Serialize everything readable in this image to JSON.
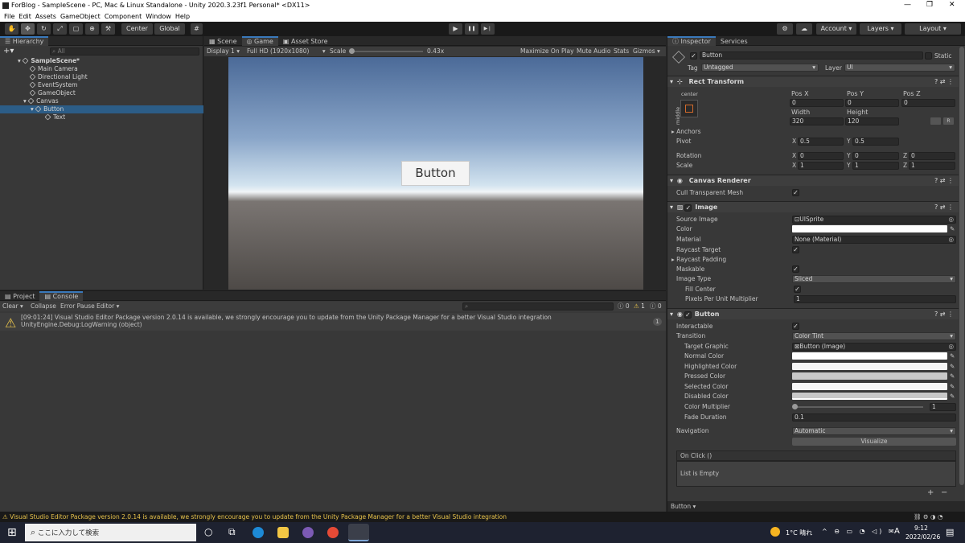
{
  "window": {
    "title": "ForBlog - SampleScene - PC, Mac & Linux Standalone - Unity 2020.3.23f1 Personal* <DX11>",
    "minimize": "—",
    "maximize": "❐",
    "close": "✕"
  },
  "menu": [
    "File",
    "Edit",
    "Assets",
    "GameObject",
    "Component",
    "Window",
    "Help"
  ],
  "toolbar": {
    "center": "Center",
    "global": "Global",
    "account": "Account",
    "layers": "Layers",
    "layout": "Layout",
    "play": "▶",
    "pause": "❚❚",
    "step": "▶❘"
  },
  "hierarchy": {
    "tab": "Hierarchy",
    "search_placeholder": "All",
    "items": [
      {
        "label": "SampleScene*"
      },
      {
        "label": "Main Camera"
      },
      {
        "label": "Directional Light"
      },
      {
        "label": "EventSystem"
      },
      {
        "label": "GameObject"
      },
      {
        "label": "Canvas"
      },
      {
        "label": "Button"
      },
      {
        "label": "Text"
      }
    ]
  },
  "game": {
    "tabs": [
      "Scene",
      "Game",
      "Asset Store"
    ],
    "display": "Display 1",
    "resolution": "Full HD (1920x1080)",
    "scale_label": "Scale",
    "scale_value": "0.43x",
    "scale_slider_fraction": 0.0,
    "maximize": "Maximize On Play",
    "mute": "Mute Audio",
    "stats": "Stats",
    "gizmos": "Gizmos",
    "button_text": "Button"
  },
  "console": {
    "tabs": [
      "Project",
      "Console"
    ],
    "clear": "Clear",
    "collapse": "Collapse",
    "error_pause": "Error Pause",
    "editor": "Editor",
    "count_info": "0",
    "count_warn": "1",
    "count_err": "0",
    "message_line1": "[09:01:24] Visual Studio Editor Package version 2.0.14 is available, we strongly encourage you to update from the Unity Package Manager for a better Visual Studio integration",
    "message_line2": "UnityEngine.Debug:LogWarning (object)",
    "message_count": "1"
  },
  "inspector": {
    "tabs": [
      "Inspector",
      "Services"
    ],
    "object_name": "Button",
    "static": "Static",
    "tag_label": "Tag",
    "tag_value": "Untagged",
    "layer_label": "Layer",
    "layer_value": "UI",
    "rect": {
      "title": "Rect Transform",
      "anchor_h": "center",
      "anchor_v": "middle",
      "posx_label": "Pos X",
      "posy_label": "Pos Y",
      "posz_label": "Pos Z",
      "posx": "0",
      "posy": "0",
      "posz": "0",
      "width_label": "Width",
      "height_label": "Height",
      "width": "320",
      "height": "120",
      "anchors": "Anchors",
      "pivot": "Pivot",
      "pivot_x": "0.5",
      "pivot_y": "0.5",
      "rotation": "Rotation",
      "rot_x": "0",
      "rot_y": "0",
      "rot_z": "0",
      "scale": "Scale",
      "scale_x": "1",
      "scale_y": "1",
      "scale_z": "1",
      "x": "X",
      "y": "Y",
      "z": "Z",
      "btn_r": "R"
    },
    "canvas_renderer": {
      "title": "Canvas Renderer",
      "cull": "Cull Transparent Mesh"
    },
    "image": {
      "title": "Image",
      "source_label": "Source Image",
      "source_value": "UISprite",
      "color_label": "Color",
      "material_label": "Material",
      "material_value": "None (Material)",
      "raycast_target": "Raycast Target",
      "raycast_padding": "Raycast Padding",
      "maskable": "Maskable",
      "image_type_label": "Image Type",
      "image_type_value": "Sliced",
      "fill_center": "Fill Center",
      "ppu_label": "Pixels Per Unit Multiplier",
      "ppu_value": "1"
    },
    "button": {
      "title": "Button",
      "interactable": "Interactable",
      "transition_label": "Transition",
      "transition_value": "Color Tint",
      "target_label": "Target Graphic",
      "target_value": "Button (Image)",
      "normal": "Normal Color",
      "highlighted": "Highlighted Color",
      "pressed": "Pressed Color",
      "selected": "Selected Color",
      "disabled": "Disabled Color",
      "multiplier_label": "Color Multiplier",
      "multiplier_value": "1",
      "fade_label": "Fade Duration",
      "fade_value": "0.1",
      "nav_label": "Navigation",
      "nav_value": "Automatic",
      "visualize": "Visualize",
      "onclick": "On Click ()",
      "list_empty": "List is Empty",
      "plus": "+",
      "minus": "−"
    },
    "footer": "Button"
  },
  "status": {
    "message": "Visual Studio Editor Package version 2.0.14 is available, we strongly encourage you to update from the Unity Package Manager for a better Visual Studio integration"
  },
  "taskbar": {
    "search": "ここに入力して検索",
    "weather": "1°C 晴れ",
    "time": "9:12",
    "date": "2022/02/26",
    "ime": "A"
  },
  "colors": {
    "accent": "#3a79bb",
    "selection": "#2c5d87",
    "warning": "#e8c34b",
    "normal": "#ffffff",
    "highlighted": "#f5f5f5",
    "pressed": "#c8c8c8",
    "selected": "#f5f5f5",
    "disabled": "#c8c8c8"
  }
}
